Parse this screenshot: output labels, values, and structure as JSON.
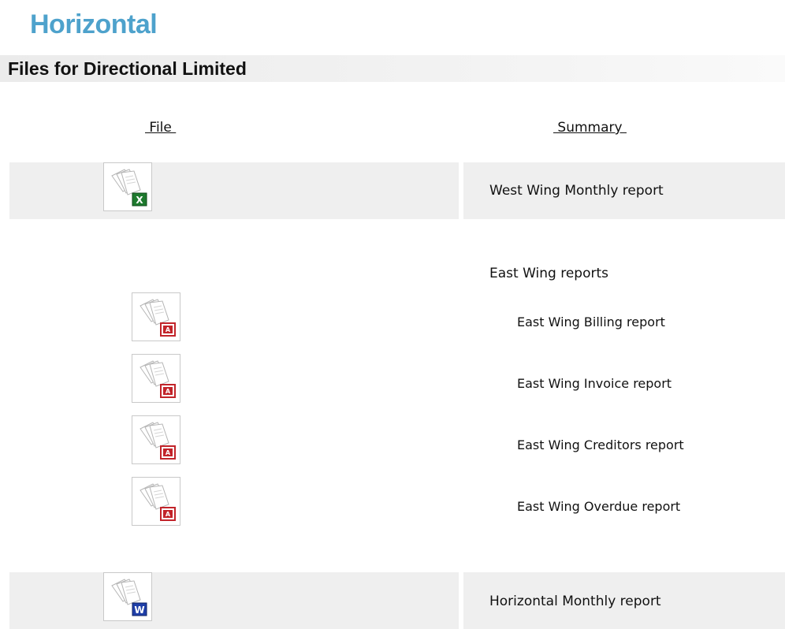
{
  "page": {
    "title": "Horizontal",
    "section_title": "Files for Directional Limited"
  },
  "table": {
    "headers": {
      "file": " File ",
      "summary": " Summary "
    },
    "rows": [
      {
        "summary": "West Wing Monthly report",
        "icon": "excel-file-icon"
      },
      {
        "summary": "East Wing reports"
      },
      {
        "summary": "East Wing Billing report",
        "icon": "pdf-file-icon"
      },
      {
        "summary": "East Wing Invoice report",
        "icon": "pdf-file-icon"
      },
      {
        "summary": "East Wing Creditors report",
        "icon": "pdf-file-icon"
      },
      {
        "summary": "East Wing Overdue report",
        "icon": "pdf-file-icon"
      },
      {
        "summary": "Horizontal Monthly report",
        "icon": "word-file-icon"
      }
    ]
  },
  "colors": {
    "title": "#4ea2cc",
    "row_highlight": "#efefef",
    "excel_badge": "#1e7a2e",
    "pdf_badge": "#c2242a",
    "word_badge": "#1f3fa8"
  }
}
